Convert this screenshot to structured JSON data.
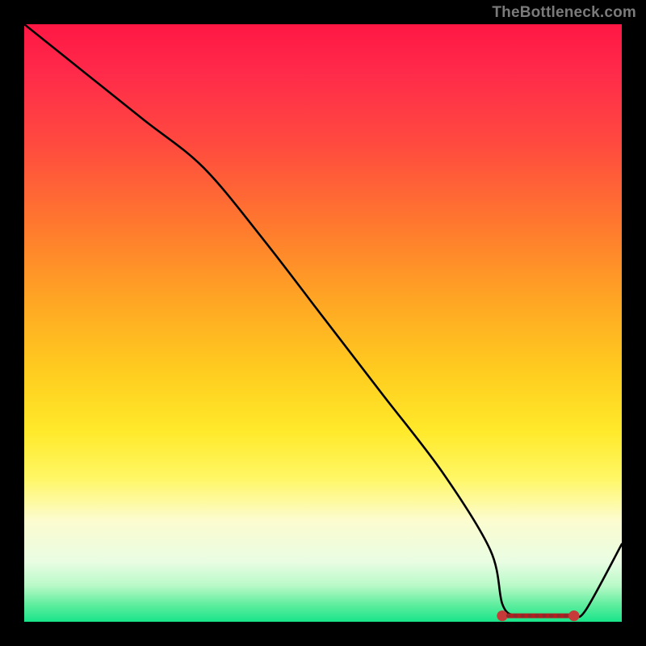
{
  "attribution": "TheBottleneck.com",
  "chart_data": {
    "type": "line",
    "title": "",
    "xlabel": "",
    "ylabel": "",
    "xlim": [
      0,
      100
    ],
    "ylim": [
      0,
      100
    ],
    "grid": false,
    "series": [
      {
        "name": "curve",
        "x": [
          0,
          10,
          20,
          30,
          40,
          50,
          60,
          70,
          78,
          80,
          82,
          84,
          86,
          88,
          90,
          92,
          94,
          100
        ],
        "y": [
          100,
          92,
          84,
          76,
          64,
          51,
          38,
          25,
          12,
          3,
          1,
          1,
          1,
          1,
          1,
          1,
          2,
          13
        ]
      }
    ],
    "flat_region": {
      "x_start": 80,
      "x_end": 92,
      "y": 1
    },
    "flat_region_markers": {
      "endpoints": [
        {
          "x": 80,
          "y": 1
        },
        {
          "x": 92,
          "y": 1
        }
      ],
      "dots_x": [
        81,
        82.2,
        83.4,
        84.6,
        85.8,
        87,
        88.2,
        89.4,
        90.6
      ]
    },
    "gradient_stops": [
      {
        "pos": 0.0,
        "color": "#ff1744"
      },
      {
        "pos": 0.5,
        "color": "#ffcc1f"
      },
      {
        "pos": 0.8,
        "color": "#fff765"
      },
      {
        "pos": 1.0,
        "color": "#18e489"
      }
    ]
  }
}
